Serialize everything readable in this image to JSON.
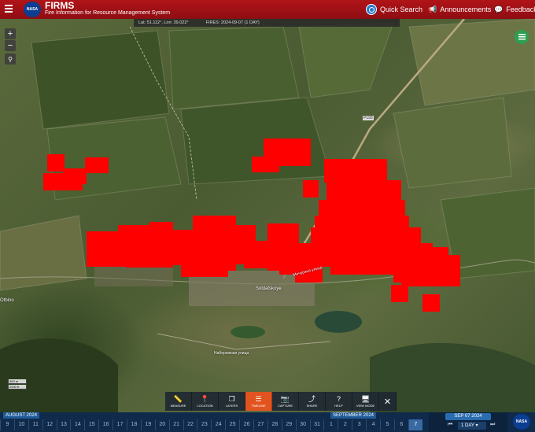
{
  "header": {
    "app_title": "FIRMS",
    "app_subtitle": "Fire Information for Resource Management System",
    "logo_text": "NASA",
    "quick_search": "Quick Search",
    "announcements": "Announcements",
    "feedback": "Feedback",
    "bg_color": "#a11116"
  },
  "map": {
    "coords": "Lat: 51.112°, Lon: 39.022°",
    "fires": "FIRES: 2024-09-07 (1 DAY)",
    "zoom_in": "+",
    "zoom_out": "−",
    "fire_color": "#ff0000",
    "places": {
      "town": "Soldatskoye",
      "left_town": "Otbino",
      "street1": "Мичурина улица",
      "street2": "Набережная улица",
      "road": "P193"
    },
    "scale": {
      "top": "500 m",
      "bottom": "2000 ft"
    }
  },
  "toolbar": {
    "items": [
      {
        "label": "MEASURE",
        "icon": "ruler-icon"
      },
      {
        "label": "LOCATION",
        "icon": "pin-icon"
      },
      {
        "label": "LAYERS",
        "icon": "layers-icon"
      },
      {
        "label": "TIMELINE",
        "icon": "timeline-icon"
      },
      {
        "label": "CAPTURE",
        "icon": "camera-icon"
      },
      {
        "label": "SHARE",
        "icon": "share-icon"
      },
      {
        "label": "HELP",
        "icon": "help-icon"
      },
      {
        "label": "VIEW MODE",
        "icon": "monitor-icon"
      }
    ],
    "close": "✕",
    "active": "TIMELINE",
    "active_color": "#e2541f"
  },
  "timeline": {
    "month_aug": "AUGUST 2024",
    "month_sep": "SEPTEMBER 2024",
    "days": [
      "9",
      "10",
      "11",
      "12",
      "13",
      "14",
      "15",
      "16",
      "17",
      "18",
      "19",
      "20",
      "21",
      "22",
      "23",
      "24",
      "25",
      "26",
      "27",
      "28",
      "29",
      "30",
      "31",
      "1",
      "2",
      "3",
      "4",
      "5",
      "6",
      "7"
    ],
    "selected_day": "7",
    "current_date": "SEP 07 2024",
    "span": "1 DAY"
  }
}
